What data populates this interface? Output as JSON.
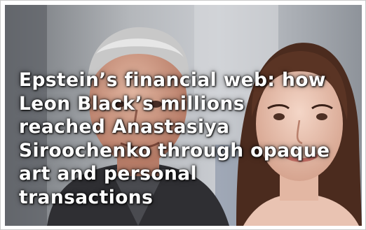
{
  "headline": {
    "lines": [
      "Epstein’s financial web: how",
      "Leon Black’s millions",
      "reached Anastasiya",
      "Siroochenko through opaque",
      "art and personal",
      "transactions"
    ]
  },
  "image": {
    "subject_icons": [
      "man-portrait-icon",
      "woman-portrait-icon"
    ]
  },
  "colors": {
    "headline_text": "#ffffff",
    "frame_border": "#c9c9c9"
  }
}
